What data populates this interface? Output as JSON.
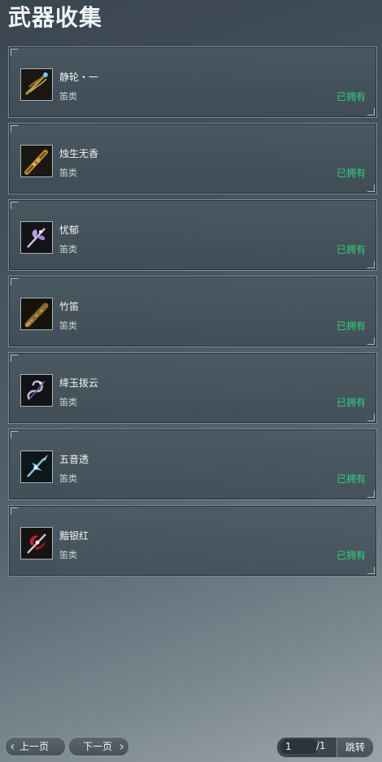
{
  "header": {
    "title": "武器收集"
  },
  "items": [
    {
      "name": "静轮・一",
      "type": "笛类",
      "status": "已拥有",
      "icon": "golden-flute-icon"
    },
    {
      "name": "烛生无香",
      "type": "笛类",
      "status": "已拥有",
      "icon": "bronze-flute-icon"
    },
    {
      "name": "忧郁",
      "type": "笛类",
      "status": "已拥有",
      "icon": "purple-flute-icon"
    },
    {
      "name": "竹笛",
      "type": "笛类",
      "status": "已拥有",
      "icon": "bamboo-flute-icon"
    },
    {
      "name": "绛玉拨云",
      "type": "笛类",
      "status": "已拥有",
      "icon": "silver-serpent-flute-icon"
    },
    {
      "name": "五音透",
      "type": "笛类",
      "status": "已拥有",
      "icon": "blue-crystal-flute-icon"
    },
    {
      "name": "黯银红",
      "type": "笛类",
      "status": "已拥有",
      "icon": "red-silver-flute-icon"
    }
  ],
  "pagination": {
    "prev_label": "上一页",
    "next_label": "下一页",
    "page_value": "1",
    "total_label": "/1",
    "jump_label": "跳转"
  },
  "colors": {
    "owned": "#2cd27a",
    "card_border": "#7b8a92"
  }
}
